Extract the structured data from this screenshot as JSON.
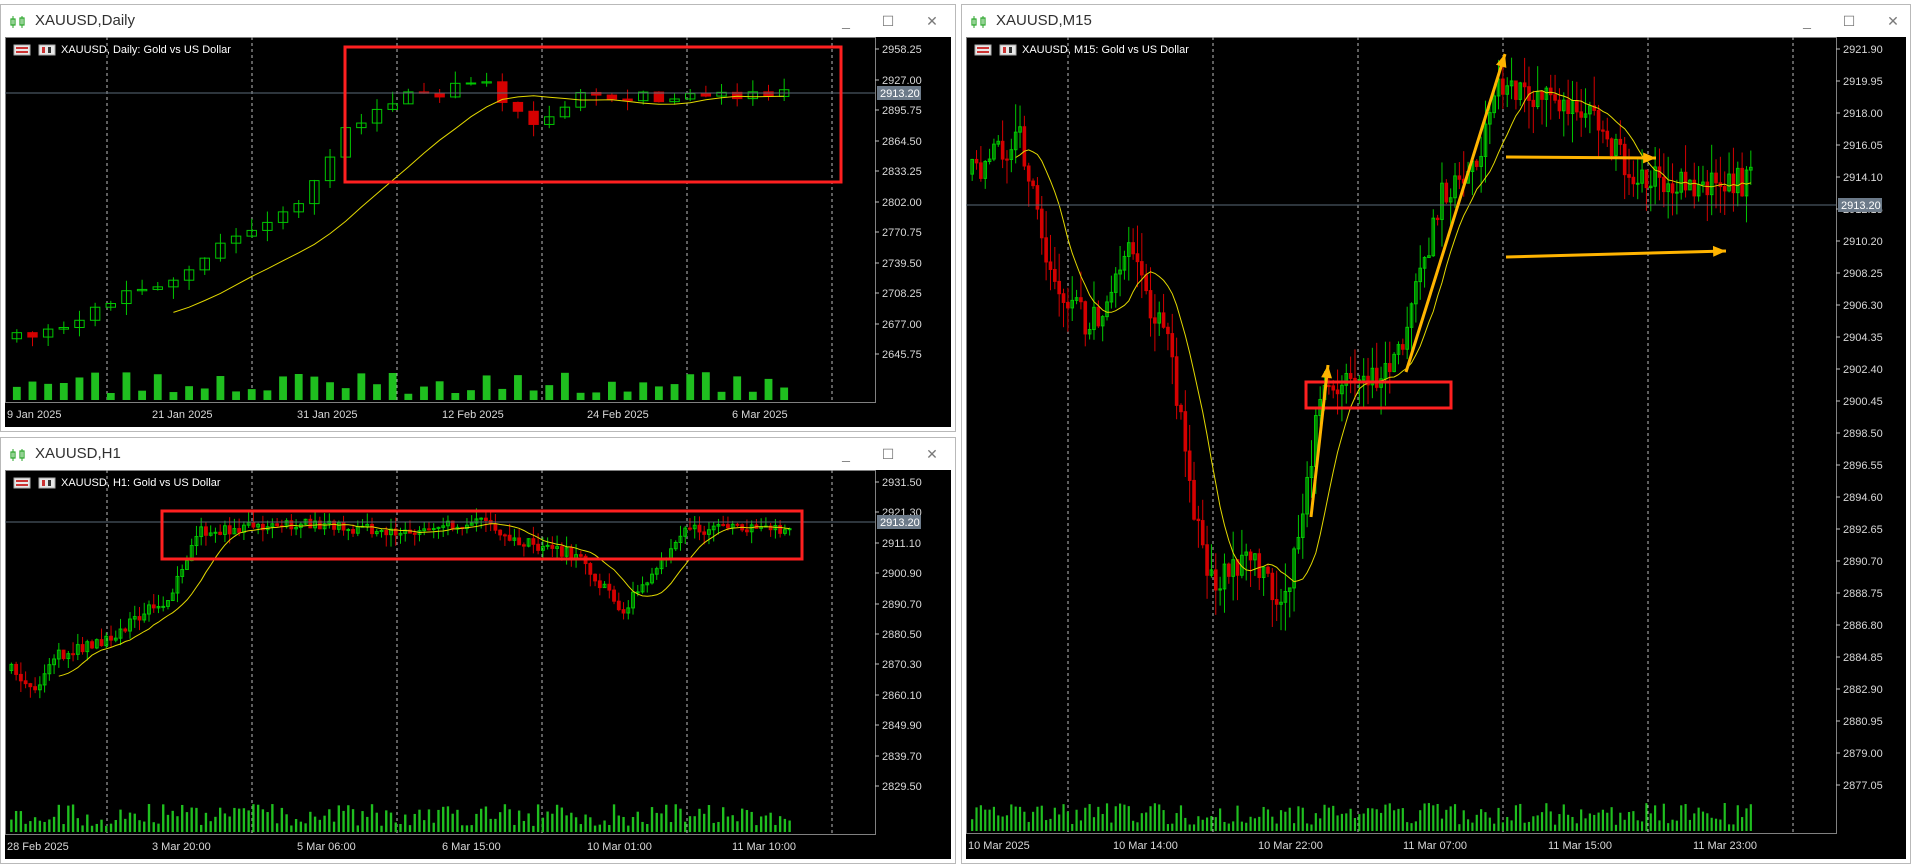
{
  "colors": {
    "bull": "#00c800",
    "bear": "#d40000",
    "ma": "#e2d800",
    "box": "#ff2020",
    "arrow": "#ffb400",
    "price_line": "#5a6a78",
    "price_tag_bg": "#6c7a89"
  },
  "windows": [
    {
      "id": "daily",
      "title": "XAUUSD,Daily",
      "symbol_label": "XAUUSD, Daily:  Gold vs US Dollar",
      "current_price": "2913.20",
      "y_ticks": [
        "2958.25",
        "2927.00",
        "2895.75",
        "2864.50",
        "2833.25",
        "2802.00",
        "2770.75",
        "2739.50",
        "2708.25",
        "2677.00",
        "2645.75"
      ],
      "x_ticks": [
        "9 Jan 2025",
        "21 Jan 2025",
        "31 Jan 2025",
        "12 Feb 2025",
        "24 Feb 2025",
        "6 Mar 2025"
      ]
    },
    {
      "id": "h1",
      "title": "XAUUSD,H1",
      "symbol_label": "XAUUSD, H1:  Gold vs US Dollar",
      "current_price": "2913.20",
      "y_ticks": [
        "2931.50",
        "2921.30",
        "2911.10",
        "2900.90",
        "2890.70",
        "2880.50",
        "2870.30",
        "2860.10",
        "2849.90",
        "2839.70",
        "2829.50"
      ],
      "x_ticks": [
        "28 Feb 2025",
        "3 Mar 20:00",
        "5 Mar 06:00",
        "6 Mar 15:00",
        "10 Mar 01:00",
        "11 Mar 10:00"
      ]
    },
    {
      "id": "m15",
      "title": "XAUUSD,M15",
      "symbol_label": "XAUUSD, M15:  Gold vs US Dollar",
      "current_price": "2913.20",
      "y_ticks": [
        "2921.90",
        "2919.95",
        "2918.00",
        "2916.05",
        "2914.10",
        "2912.15",
        "2910.20",
        "2908.25",
        "2906.30",
        "2904.35",
        "2902.40",
        "2900.45",
        "2898.50",
        "2896.55",
        "2894.60",
        "2892.65",
        "2890.70",
        "2888.75",
        "2886.80",
        "2884.85",
        "2882.90",
        "2880.95",
        "2879.00",
        "2877.05"
      ],
      "x_ticks": [
        "10 Mar 2025",
        "10 Mar 14:00",
        "10 Mar 22:00",
        "11 Mar 07:00",
        "11 Mar 15:00",
        "11 Mar 23:00"
      ]
    }
  ],
  "window_buttons": {
    "minimize": "_",
    "maximize": "☐",
    "close": "✕"
  }
}
